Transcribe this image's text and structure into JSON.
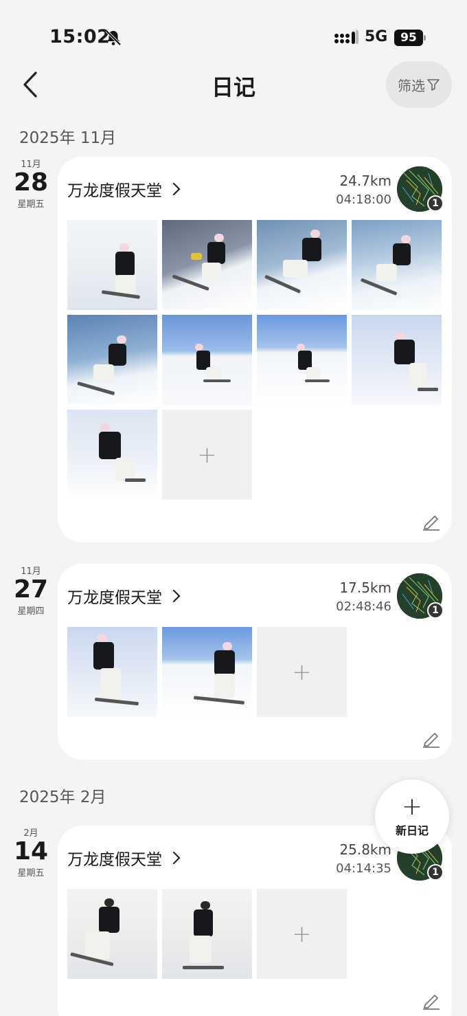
{
  "status_bar": {
    "time": "15:02",
    "network": "5G",
    "battery": "95"
  },
  "header": {
    "title": "日记",
    "filter_label": "筛选"
  },
  "sections": [
    {
      "label": "2025年 11月",
      "entries": [
        {
          "month": "11月",
          "day": "28",
          "weekday": "星期五",
          "resort": "万龙度假天堂",
          "distance": "24.7km",
          "duration": "04:18:00",
          "map_badge": "1",
          "photo_count": 9
        },
        {
          "month": "11月",
          "day": "27",
          "weekday": "星期四",
          "resort": "万龙度假天堂",
          "distance": "17.5km",
          "duration": "02:48:46",
          "map_badge": "1",
          "photo_count": 2
        }
      ]
    },
    {
      "label": "2025年 2月",
      "entries": [
        {
          "month": "2月",
          "day": "14",
          "weekday": "星期五",
          "resort": "万龙度假天堂",
          "distance": "25.8km",
          "duration": "04:14:35",
          "map_badge": "1",
          "photo_count": 2
        }
      ]
    }
  ],
  "fab": {
    "plus": "+",
    "label": "新日记"
  },
  "add_tile_symbol": "+",
  "icons": [
    "bell-slash-icon",
    "signal-icon",
    "back-chevron-icon",
    "filter-funnel-icon",
    "chevron-right-icon",
    "edit-pencil-icon",
    "plus-icon"
  ]
}
